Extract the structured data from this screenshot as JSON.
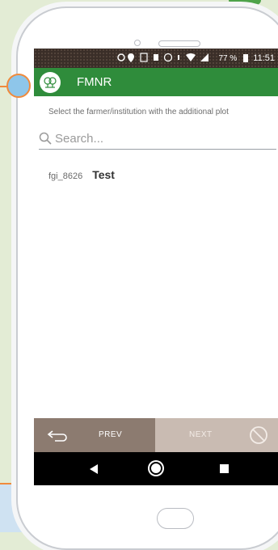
{
  "status_bar": {
    "icons": [
      "target-icon",
      "location-icon",
      "nfc-icon",
      "vibrate-icon",
      "alarm-icon",
      "data-icon",
      "wifi-icon",
      "signal-icon"
    ],
    "battery_percent": "77 %",
    "time": "11:51"
  },
  "app_bar": {
    "title": "FMNR",
    "color": "#2f8c3b"
  },
  "instruction": "Select the farmer/institution with the additional plot",
  "search": {
    "placeholder": "Search..."
  },
  "list": {
    "items": [
      {
        "id": "fgi_8626",
        "name": "Test"
      }
    ]
  },
  "navigation": {
    "prev_label": "PREV",
    "next_label": "NEXT"
  },
  "colors": {
    "accent": "#2f8c3b",
    "prev_button": "#8c7b70",
    "next_button_disabled": "#c9bbb2",
    "callout": "#f08a3c"
  }
}
